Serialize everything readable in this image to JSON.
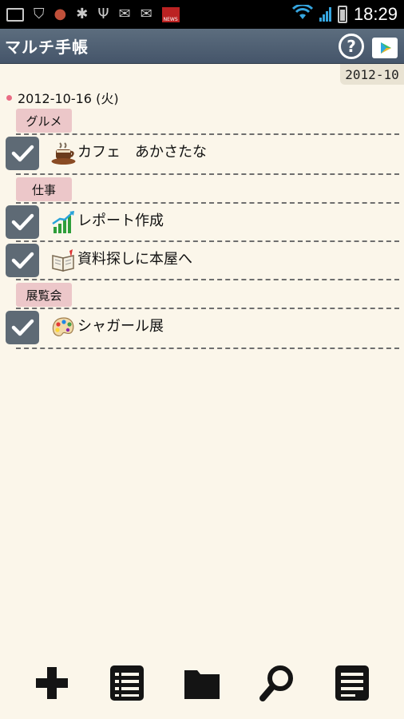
{
  "status_bar": {
    "time": "18:29",
    "left_icons": [
      "calendar-alarm-icon",
      "shield-icon",
      "globe-badge-icon",
      "android-bug-icon",
      "usb-icon",
      "gmail-icon",
      "gmail-icon",
      "news-icon"
    ],
    "right_icons": [
      "wifi-icon",
      "signal-icon",
      "battery-icon"
    ]
  },
  "app": {
    "title": "マルチ手帳",
    "help_label": "?",
    "header_color": "#4e5e70"
  },
  "month_tab": {
    "label": "2012-10"
  },
  "date": {
    "label": "2012-10-16 (火)",
    "accent": "#e96c84"
  },
  "sections": [
    {
      "category": "グルメ",
      "tasks": [
        {
          "label": "カフェ　あかさたな",
          "icon": "coffee-cup-icon",
          "checked": true
        }
      ]
    },
    {
      "category": "仕事",
      "tasks": [
        {
          "label": "レポート作成",
          "icon": "bar-chart-icon",
          "checked": true
        },
        {
          "label": "資料探しに本屋へ",
          "icon": "open-book-icon",
          "checked": true
        }
      ]
    },
    {
      "category": "展覧会",
      "tasks": [
        {
          "label": "シャガール展",
          "icon": "palette-icon",
          "checked": true
        }
      ]
    }
  ],
  "toolbar": {
    "buttons": [
      "add-icon",
      "list-icon",
      "folder-icon",
      "search-icon",
      "memo-icon"
    ]
  },
  "colors": {
    "background": "#fbf6ea",
    "category_tag": "#ecc7c9",
    "checkbox": "#5e6a75"
  }
}
